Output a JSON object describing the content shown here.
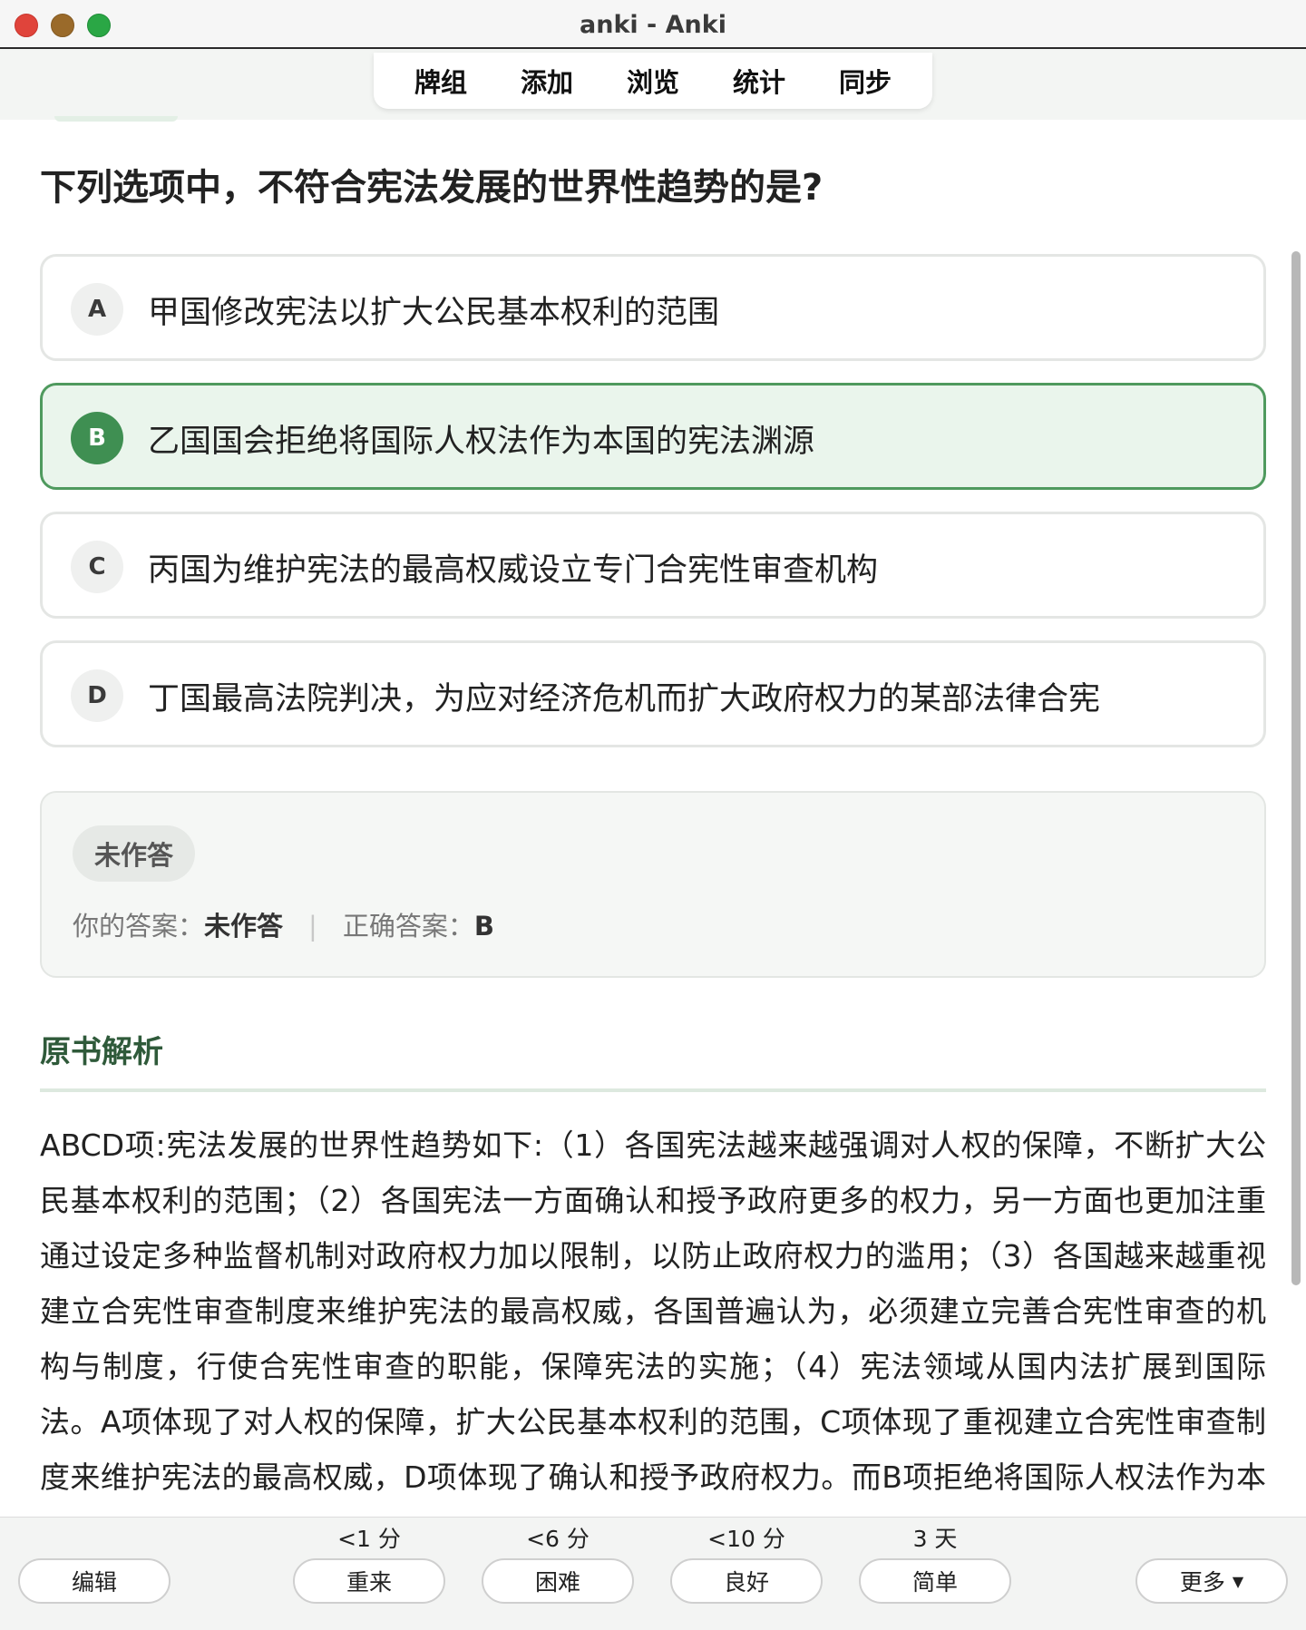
{
  "window": {
    "title": "anki - Anki"
  },
  "toolbar": {
    "items": [
      "牌组",
      "添加",
      "浏览",
      "统计",
      "同步"
    ]
  },
  "card": {
    "question": "下列选项中，不符合宪法发展的世界性趋势的是?",
    "options": [
      {
        "letter": "A",
        "text": "甲国修改宪法以扩大公民基本权利的范围",
        "correct": false
      },
      {
        "letter": "B",
        "text": "乙国国会拒绝将国际人权法作为本国的宪法渊源",
        "correct": true
      },
      {
        "letter": "C",
        "text": "丙国为维护宪法的最高权威设立专门合宪性审查机构",
        "correct": false
      },
      {
        "letter": "D",
        "text": "丁国最高法院判决，为应对经济危机而扩大政府权力的某部法律合宪",
        "correct": false
      }
    ],
    "result": {
      "status": "未作答",
      "your_answer_label": "你的答案：",
      "your_answer": "未作答",
      "separator": "|",
      "correct_answer_label": "正确答案：",
      "correct_answer": "B"
    },
    "analysis_title": "原书解析",
    "analysis_text": "ABCD项:宪法发展的世界性趋势如下:（1）各国宪法越来越强调对人权的保障，不断扩大公民基本权利的范围；（2）各国宪法一方面确认和授予政府更多的权力，另一方面也更加注重通过设定多种监督机制对政府权力加以限制，以防止政府权力的滥用；（3）各国越来越重视建立合宪性审查制度来维护宪法的最高权威，各国普遍认为，必须建立完善合宪性审查的机构与制度，行使合宪性审查的职能，保障宪法的实施；（4）宪法领域从国内法扩展到国际法。A项体现了对人权的保障，扩大公民基本权利的范围，C项体现了重视建立合宪性审查制度来维护宪法的最高权威，D项体现了确认和授予政府权力。而B项拒绝将国际人权法作为本国的宪法渊源明显违背了宪法发展的世界趋势。因此，B项错误，ACD项正"
  },
  "bottom": {
    "edit_label": "编辑",
    "more_label": "更多",
    "answers": [
      {
        "interval": "<1 分",
        "label": "重来"
      },
      {
        "interval": "<6 分",
        "label": "困难"
      },
      {
        "interval": "<10 分",
        "label": "良好"
      },
      {
        "interval": "3 天",
        "label": "简单"
      }
    ]
  },
  "colors": {
    "accent_green": "#3f8f52",
    "correct_bg": "#eaf5ec",
    "section_title": "#2f5a3a"
  }
}
